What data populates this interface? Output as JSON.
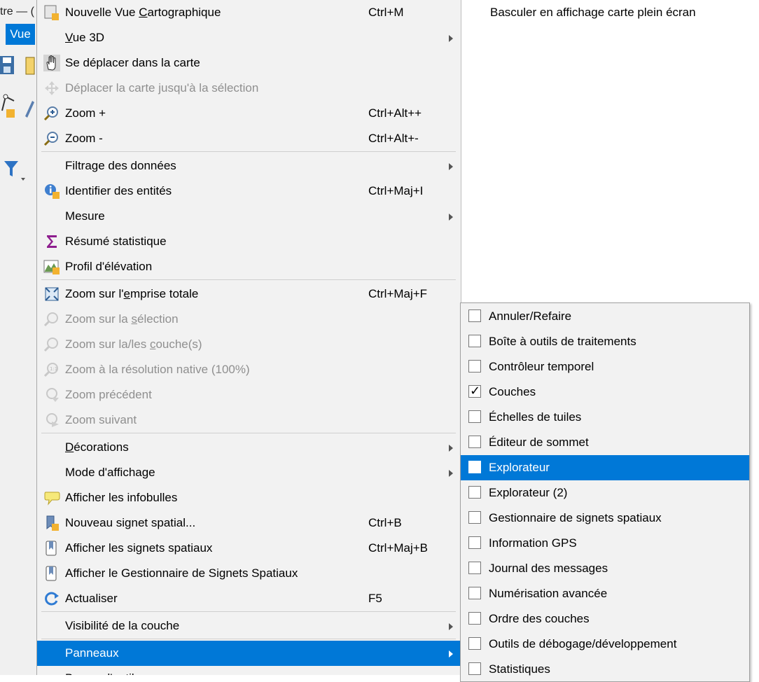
{
  "background_app": {
    "title_fragment": "tre — (",
    "menu_vue": "Vue"
  },
  "main_menu": {
    "items": [
      {
        "label": "Nouvelle Vue Cartographique",
        "shortcut": "Ctrl+M",
        "icon": "new-map-view-icon",
        "enabled": true
      },
      {
        "label": "Vue 3D",
        "shortcut": "",
        "icon": "",
        "submenu": true,
        "enabled": true
      },
      {
        "label": "Se déplacer dans la carte",
        "shortcut": "",
        "icon": "pan-hand-icon",
        "enabled": true
      },
      {
        "label": "Déplacer la carte jusqu'à la sélection",
        "shortcut": "",
        "icon": "pan-to-selection-icon",
        "enabled": false
      },
      {
        "label": "Zoom +",
        "shortcut": "Ctrl+Alt++",
        "icon": "zoom-in-icon",
        "enabled": true
      },
      {
        "label": "Zoom -",
        "shortcut": "Ctrl+Alt+-",
        "icon": "zoom-out-icon",
        "enabled": true
      },
      {
        "label": "Filtrage des données",
        "shortcut": "",
        "icon": "",
        "submenu": true,
        "enabled": true
      },
      {
        "label": "Identifier des entités",
        "shortcut": "Ctrl+Maj+I",
        "icon": "identify-icon",
        "enabled": true
      },
      {
        "label": "Mesure",
        "shortcut": "",
        "icon": "",
        "submenu": true,
        "enabled": true
      },
      {
        "label": "Résumé statistique",
        "shortcut": "",
        "icon": "sigma-icon",
        "enabled": true
      },
      {
        "label": "Profil d'élévation",
        "shortcut": "",
        "icon": "elevation-profile-icon",
        "enabled": true
      },
      {
        "label": "Zoom sur l'emprise totale",
        "shortcut": "Ctrl+Maj+F",
        "icon": "zoom-full-icon",
        "enabled": true
      },
      {
        "label": "Zoom sur la sélection",
        "shortcut": "",
        "icon": "zoom-selection-icon",
        "enabled": false
      },
      {
        "label": "Zoom sur la/les couche(s)",
        "shortcut": "",
        "icon": "zoom-layer-icon",
        "enabled": false
      },
      {
        "label": "Zoom à la résolution native (100%)",
        "shortcut": "",
        "icon": "zoom-native-icon",
        "enabled": false
      },
      {
        "label": "Zoom précédent",
        "shortcut": "",
        "icon": "zoom-previous-icon",
        "enabled": false
      },
      {
        "label": "Zoom suivant",
        "shortcut": "",
        "icon": "zoom-next-icon",
        "enabled": false
      },
      {
        "label": "Décorations",
        "shortcut": "",
        "icon": "",
        "submenu": true,
        "enabled": true
      },
      {
        "label": "Mode d'affichage",
        "shortcut": "",
        "icon": "",
        "submenu": true,
        "enabled": true
      },
      {
        "label": "Afficher les infobulles",
        "shortcut": "",
        "icon": "map-tips-icon",
        "enabled": true
      },
      {
        "label": "Nouveau signet spatial...",
        "shortcut": "Ctrl+B",
        "icon": "new-bookmark-icon",
        "enabled": true
      },
      {
        "label": "Afficher les signets spatiaux",
        "shortcut": "Ctrl+Maj+B",
        "icon": "bookmarks-icon",
        "enabled": true
      },
      {
        "label": "Afficher le Gestionnaire de Signets Spatiaux",
        "shortcut": "",
        "icon": "bookmark-manager-icon",
        "enabled": true
      },
      {
        "label": "Actualiser",
        "shortcut": "F5",
        "icon": "refresh-icon",
        "enabled": true
      },
      {
        "label": "Visibilité de la couche",
        "shortcut": "",
        "icon": "",
        "submenu": true,
        "enabled": true
      },
      {
        "label": "Panneaux",
        "shortcut": "",
        "icon": "",
        "submenu": true,
        "enabled": true,
        "highlighted": true
      },
      {
        "label": "Barres d'outils",
        "shortcut": "",
        "icon": "",
        "submenu": true,
        "enabled": true
      }
    ]
  },
  "tooltip": "Basculer en affichage carte plein écran",
  "panels_submenu": {
    "items": [
      {
        "label": "Annuler/Refaire",
        "checked": false
      },
      {
        "label": "Boîte à outils de traitements",
        "checked": false
      },
      {
        "label": "Contrôleur temporel",
        "checked": false
      },
      {
        "label": "Couches",
        "checked": true
      },
      {
        "label": "Échelles de tuiles",
        "checked": false
      },
      {
        "label": "Éditeur de sommet",
        "checked": false
      },
      {
        "label": "Explorateur",
        "checked": false,
        "highlighted": true
      },
      {
        "label": "Explorateur (2)",
        "checked": false
      },
      {
        "label": "Gestionnaire de signets spatiaux",
        "checked": false
      },
      {
        "label": "Information GPS",
        "checked": false
      },
      {
        "label": "Journal des messages",
        "checked": false
      },
      {
        "label": "Numérisation avancée",
        "checked": false
      },
      {
        "label": "Ordre des couches",
        "checked": false
      },
      {
        "label": "Outils de débogage/développement",
        "checked": false
      },
      {
        "label": "Statistiques",
        "checked": false
      }
    ]
  },
  "colors": {
    "highlight": "#0078d7",
    "menu_bg": "#f2f2f2",
    "disabled_text": "#8f8f8f"
  }
}
